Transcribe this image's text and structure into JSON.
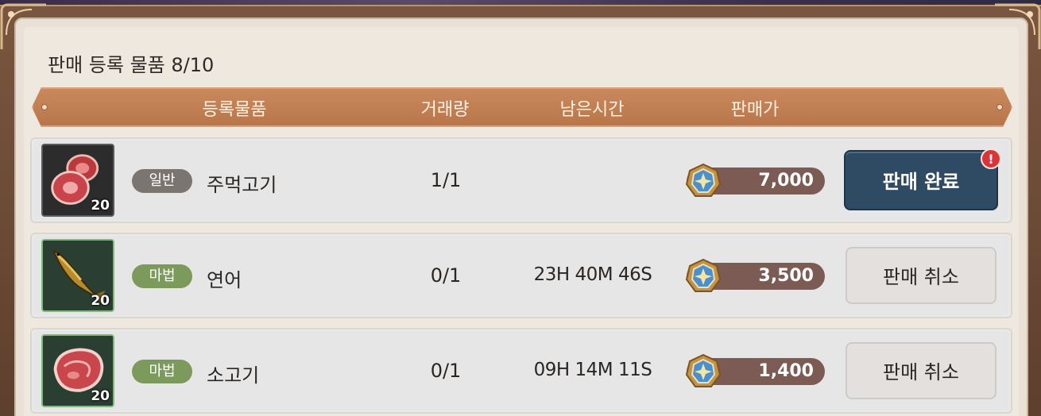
{
  "section": {
    "title": "판매 등록 물품 8/10"
  },
  "header": {
    "col_item": "등록물품",
    "col_trade": "거래량",
    "col_time": "남은시간",
    "col_price": "판매가"
  },
  "rows": [
    {
      "icon": "meat-icon",
      "quantity": "20",
      "grade": "일반",
      "grade_type": "common",
      "name": "주먹고기",
      "trade": "1/1",
      "time": "",
      "price": "7,000",
      "action": "판매 완료",
      "action_type": "complete",
      "alert": "!"
    },
    {
      "icon": "salmon-icon",
      "quantity": "20",
      "grade": "마법",
      "grade_type": "magic",
      "name": "연어",
      "trade": "0/1",
      "time": "23H 40M 46S",
      "price": "3,500",
      "action": "판매 취소",
      "action_type": "cancel"
    },
    {
      "icon": "beef-icon",
      "quantity": "20",
      "grade": "마법",
      "grade_type": "magic",
      "name": "소고기",
      "trade": "0/1",
      "time": "09H 14M 11S",
      "price": "1,400",
      "action": "판매 취소",
      "action_type": "cancel"
    }
  ],
  "colors": {
    "header": "#c07e52",
    "complete_button": "#2f4b63",
    "common_grade": "#7a7570",
    "magic_grade": "#7b9a5c",
    "price_bar": "#7b5b53"
  }
}
